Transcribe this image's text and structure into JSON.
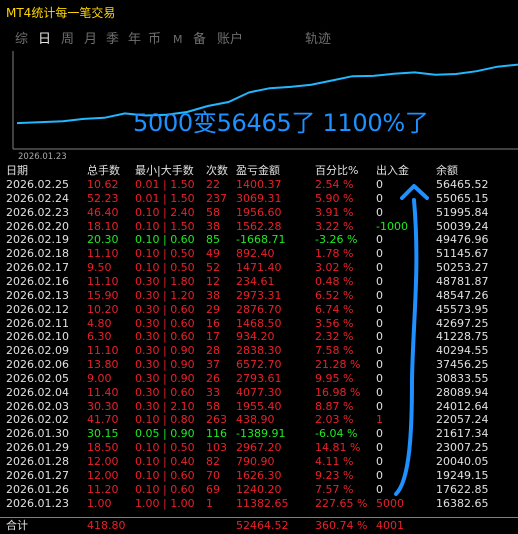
{
  "window": {
    "title": "MT4统计每一笔交易"
  },
  "tabs": [
    {
      "label": "综",
      "active": false
    },
    {
      "label": "日",
      "active": true
    },
    {
      "label": "周",
      "active": false
    },
    {
      "label": "月",
      "active": false
    },
    {
      "label": "季",
      "active": false
    },
    {
      "label": "年",
      "active": false
    },
    {
      "label": "币",
      "active": false
    },
    {
      "label": "M",
      "active": false
    },
    {
      "label": "备",
      "active": false
    },
    {
      "label": "账户",
      "active": false
    },
    {
      "label": "轨迹",
      "active": false
    }
  ],
  "chart_data": {
    "type": "line",
    "x": [
      "2026.01.23",
      "2026.01.26",
      "2026.01.27",
      "2026.01.28",
      "2026.01.29",
      "2026.01.30",
      "2026.02.02",
      "2026.02.03",
      "2026.02.04",
      "2026.02.05",
      "2026.02.06",
      "2026.02.09",
      "2026.02.10",
      "2026.02.11",
      "2026.02.12",
      "2026.02.13",
      "2026.02.16",
      "2026.02.17",
      "2026.02.18",
      "2026.02.19",
      "2026.02.20",
      "2026.02.23",
      "2026.02.24",
      "2026.02.25"
    ],
    "values": [
      16382.65,
      17622.85,
      19249.15,
      20040.05,
      23007.25,
      21617.34,
      22057.24,
      24012.64,
      28089.94,
      30833.55,
      37456.25,
      40294.55,
      41228.75,
      42697.25,
      45573.95,
      48547.26,
      48781.87,
      50253.27,
      51145.67,
      49476.96,
      50039.24,
      51995.84,
      55065.15,
      56465.52
    ],
    "x_start_label": "2026.01.23",
    "color": "#22b8ff"
  },
  "annotation": {
    "text": "5000变56465了 1100%了"
  },
  "table": {
    "headers": [
      "日期",
      "总手数",
      "最小|大手数",
      "次数",
      "盈亏金额",
      "百分比%",
      "出入金",
      "余额"
    ],
    "rows": [
      {
        "date": "2026.02.25",
        "lots": "10.62",
        "minmax": "0.01 | 1.50",
        "count": "22",
        "pnl": "1400.37",
        "pct": "2.54 %",
        "io": "0",
        "bal": "56465.52",
        "sign": "pos",
        "io_color": "white"
      },
      {
        "date": "2026.02.24",
        "lots": "52.23",
        "minmax": "0.01 | 1.50",
        "count": "237",
        "pnl": "3069.31",
        "pct": "5.90 %",
        "io": "0",
        "bal": "55065.15",
        "sign": "pos",
        "io_color": "white"
      },
      {
        "date": "2026.02.23",
        "lots": "46.40",
        "minmax": "0.10 | 2.40",
        "count": "58",
        "pnl": "1956.60",
        "pct": "3.91 %",
        "io": "0",
        "bal": "51995.84",
        "sign": "pos",
        "io_color": "white"
      },
      {
        "date": "2026.02.20",
        "lots": "18.10",
        "minmax": "0.10 | 1.50",
        "count": "38",
        "pnl": "1562.28",
        "pct": "3.22 %",
        "io": "-1000",
        "bal": "50039.24",
        "sign": "pos",
        "io_color": "green"
      },
      {
        "date": "2026.02.19",
        "lots": "20.30",
        "minmax": "0.10 | 0.60",
        "count": "85",
        "pnl": "-1668.71",
        "pct": "-3.26 %",
        "io": "0",
        "bal": "49476.96",
        "sign": "neg",
        "io_color": "white"
      },
      {
        "date": "2026.02.18",
        "lots": "11.10",
        "minmax": "0.10 | 0.50",
        "count": "49",
        "pnl": "892.40",
        "pct": "1.78 %",
        "io": "0",
        "bal": "51145.67",
        "sign": "pos",
        "io_color": "white"
      },
      {
        "date": "2026.02.17",
        "lots": "9.50",
        "minmax": "0.10 | 0.50",
        "count": "52",
        "pnl": "1471.40",
        "pct": "3.02 %",
        "io": "0",
        "bal": "50253.27",
        "sign": "pos",
        "io_color": "white"
      },
      {
        "date": "2026.02.16",
        "lots": "11.10",
        "minmax": "0.30 | 1.80",
        "count": "12",
        "pnl": "234.61",
        "pct": "0.48 %",
        "io": "0",
        "bal": "48781.87",
        "sign": "pos",
        "io_color": "white"
      },
      {
        "date": "2026.02.13",
        "lots": "15.90",
        "minmax": "0.30 | 1.20",
        "count": "38",
        "pnl": "2973.31",
        "pct": "6.52 %",
        "io": "0",
        "bal": "48547.26",
        "sign": "pos",
        "io_color": "white"
      },
      {
        "date": "2026.02.12",
        "lots": "10.20",
        "minmax": "0.30 | 0.60",
        "count": "29",
        "pnl": "2876.70",
        "pct": "6.74 %",
        "io": "0",
        "bal": "45573.95",
        "sign": "pos",
        "io_color": "white"
      },
      {
        "date": "2026.02.11",
        "lots": "4.80",
        "minmax": "0.30 | 0.60",
        "count": "16",
        "pnl": "1468.50",
        "pct": "3.56 %",
        "io": "0",
        "bal": "42697.25",
        "sign": "pos",
        "io_color": "white"
      },
      {
        "date": "2026.02.10",
        "lots": "6.30",
        "minmax": "0.30 | 0.60",
        "count": "17",
        "pnl": "934.20",
        "pct": "2.32 %",
        "io": "0",
        "bal": "41228.75",
        "sign": "pos",
        "io_color": "white"
      },
      {
        "date": "2026.02.09",
        "lots": "11.10",
        "minmax": "0.30 | 0.90",
        "count": "28",
        "pnl": "2838.30",
        "pct": "7.58 %",
        "io": "0",
        "bal": "40294.55",
        "sign": "pos",
        "io_color": "white"
      },
      {
        "date": "2026.02.06",
        "lots": "13.80",
        "minmax": "0.30 | 0.90",
        "count": "37",
        "pnl": "6572.70",
        "pct": "21.28 %",
        "io": "0",
        "bal": "37456.25",
        "sign": "pos",
        "io_color": "white"
      },
      {
        "date": "2026.02.05",
        "lots": "9.00",
        "minmax": "0.30 | 0.90",
        "count": "26",
        "pnl": "2793.61",
        "pct": "9.95 %",
        "io": "0",
        "bal": "30833.55",
        "sign": "pos",
        "io_color": "white"
      },
      {
        "date": "2026.02.04",
        "lots": "11.40",
        "minmax": "0.30 | 0.60",
        "count": "33",
        "pnl": "4077.30",
        "pct": "16.98 %",
        "io": "0",
        "bal": "28089.94",
        "sign": "pos",
        "io_color": "white"
      },
      {
        "date": "2026.02.03",
        "lots": "30.30",
        "minmax": "0.30 | 2.10",
        "count": "58",
        "pnl": "1955.40",
        "pct": "8.87 %",
        "io": "0",
        "bal": "24012.64",
        "sign": "pos",
        "io_color": "white"
      },
      {
        "date": "2026.02.02",
        "lots": "41.70",
        "minmax": "0.10 | 0.80",
        "count": "263",
        "pnl": "438.90",
        "pct": "2.03 %",
        "io": "1",
        "bal": "22057.24",
        "sign": "pos",
        "io_color": "red"
      },
      {
        "date": "2026.01.30",
        "lots": "30.15",
        "minmax": "0.05 | 0.90",
        "count": "116",
        "pnl": "-1389.91",
        "pct": "-6.04 %",
        "io": "0",
        "bal": "21617.34",
        "sign": "neg",
        "io_color": "white"
      },
      {
        "date": "2026.01.29",
        "lots": "18.50",
        "minmax": "0.10 | 0.50",
        "count": "103",
        "pnl": "2967.20",
        "pct": "14.81 %",
        "io": "0",
        "bal": "23007.25",
        "sign": "pos",
        "io_color": "white"
      },
      {
        "date": "2026.01.28",
        "lots": "12.00",
        "minmax": "0.10 | 0.40",
        "count": "82",
        "pnl": "790.90",
        "pct": "4.11 %",
        "io": "0",
        "bal": "20040.05",
        "sign": "pos",
        "io_color": "white"
      },
      {
        "date": "2026.01.27",
        "lots": "12.00",
        "minmax": "0.10 | 0.60",
        "count": "70",
        "pnl": "1626.30",
        "pct": "9.23 %",
        "io": "0",
        "bal": "19249.15",
        "sign": "pos",
        "io_color": "white"
      },
      {
        "date": "2026.01.26",
        "lots": "11.20",
        "minmax": "0.10 | 0.60",
        "count": "69",
        "pnl": "1240.20",
        "pct": "7.57 %",
        "io": "0",
        "bal": "17622.85",
        "sign": "pos",
        "io_color": "white"
      },
      {
        "date": "2026.01.23",
        "lots": "1.00",
        "minmax": "1.00 | 1.00",
        "count": "1",
        "pnl": "11382.65",
        "pct": "227.65 %",
        "io": "5000",
        "bal": "16382.65",
        "sign": "pos",
        "io_color": "red"
      }
    ],
    "totals": {
      "label": "合计",
      "lots": "418.80",
      "pnl": "52464.52",
      "pct": "360.74 %",
      "io": "4001"
    }
  },
  "colors": {
    "positive": "#e8202a",
    "negative": "#22e822",
    "neutral": "#e0e0e0",
    "title": "#ffd700",
    "annotation": "#1e90ff"
  }
}
